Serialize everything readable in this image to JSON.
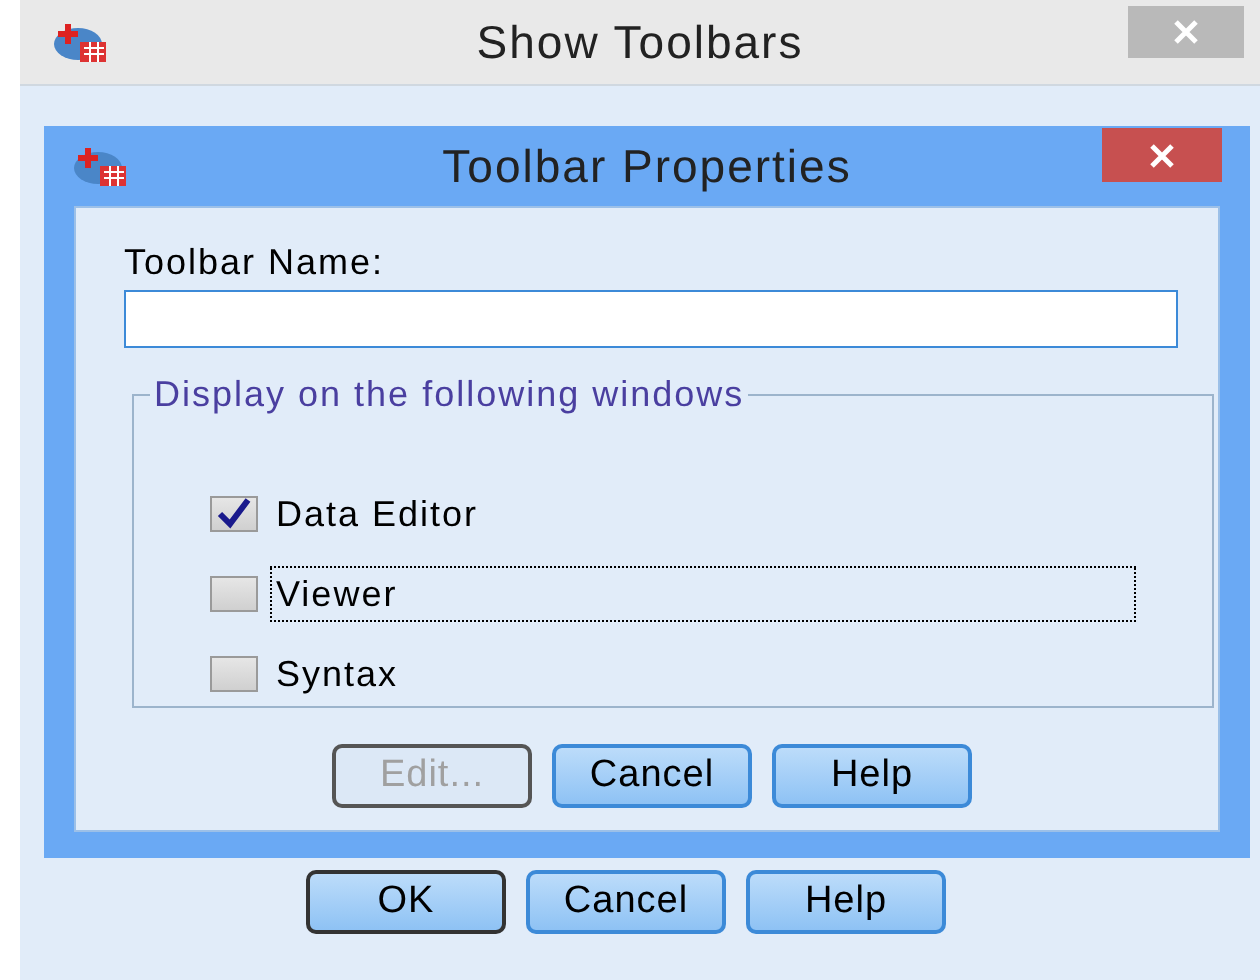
{
  "window": {
    "title": "Show Toolbars"
  },
  "dialog": {
    "title": "Toolbar Properties",
    "name_field": {
      "label": "Toolbar Name:"
    },
    "group": {
      "title": "Display on the following windows",
      "options": [
        {
          "label": "Data Editor",
          "checked": true,
          "focused": false
        },
        {
          "label": "Viewer",
          "checked": false,
          "focused": true
        },
        {
          "label": "Syntax",
          "checked": false,
          "focused": false
        }
      ]
    },
    "buttons": [
      {
        "label": "Edit...",
        "disabled": true,
        "default": false
      },
      {
        "label": "Cancel",
        "disabled": false,
        "default": false
      },
      {
        "label": "Help",
        "disabled": false,
        "default": false
      }
    ]
  },
  "buttons": [
    {
      "label": "OK",
      "disabled": false,
      "default": true
    },
    {
      "label": "Cancel",
      "disabled": false,
      "default": false
    },
    {
      "label": "Help",
      "disabled": false,
      "default": false
    }
  ]
}
